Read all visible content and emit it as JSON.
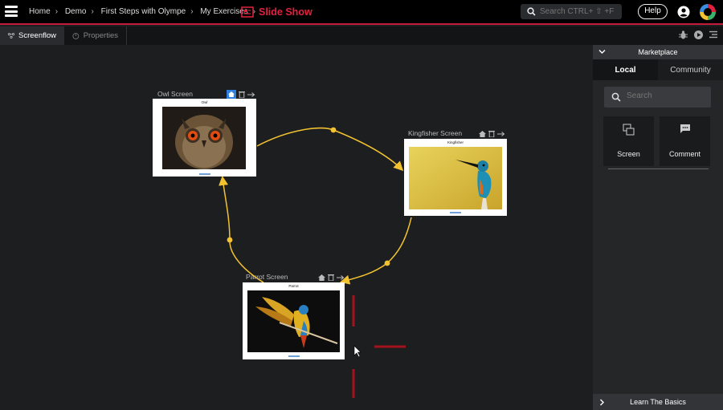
{
  "topbar": {
    "breadcrumbs": [
      "Home",
      "Demo",
      "First Steps with Olympe",
      "My Exercises"
    ],
    "title": "Slide Show",
    "search_placeholder": "Search CTRL+ ⇧ +F",
    "help_label": "Help",
    "accent_color": "#c21c3a"
  },
  "tabs": [
    {
      "label": "Screenflow",
      "icon": "screenflow-icon",
      "active": true
    },
    {
      "label": "Properties",
      "icon": "properties-icon",
      "active": false
    }
  ],
  "tab_tools": [
    "bug-icon",
    "play-icon",
    "list-icon"
  ],
  "canvas": {
    "screens": [
      {
        "name": "Owl Screen",
        "caption": "Owl"
      },
      {
        "name": "Kingfisher Screen",
        "caption": "Kingfisher"
      },
      {
        "name": "Parrot Screen",
        "caption": "Parrot"
      }
    ],
    "link_color": "#f2c230"
  },
  "sidebar": {
    "header": "Marketplace",
    "tabs": [
      "Local",
      "Community"
    ],
    "search_placeholder": "Search",
    "components": [
      {
        "label": "Screen",
        "icon": "screen-icon"
      },
      {
        "label": "Comment",
        "icon": "comment-icon"
      }
    ],
    "footer": "Learn The Basics"
  }
}
